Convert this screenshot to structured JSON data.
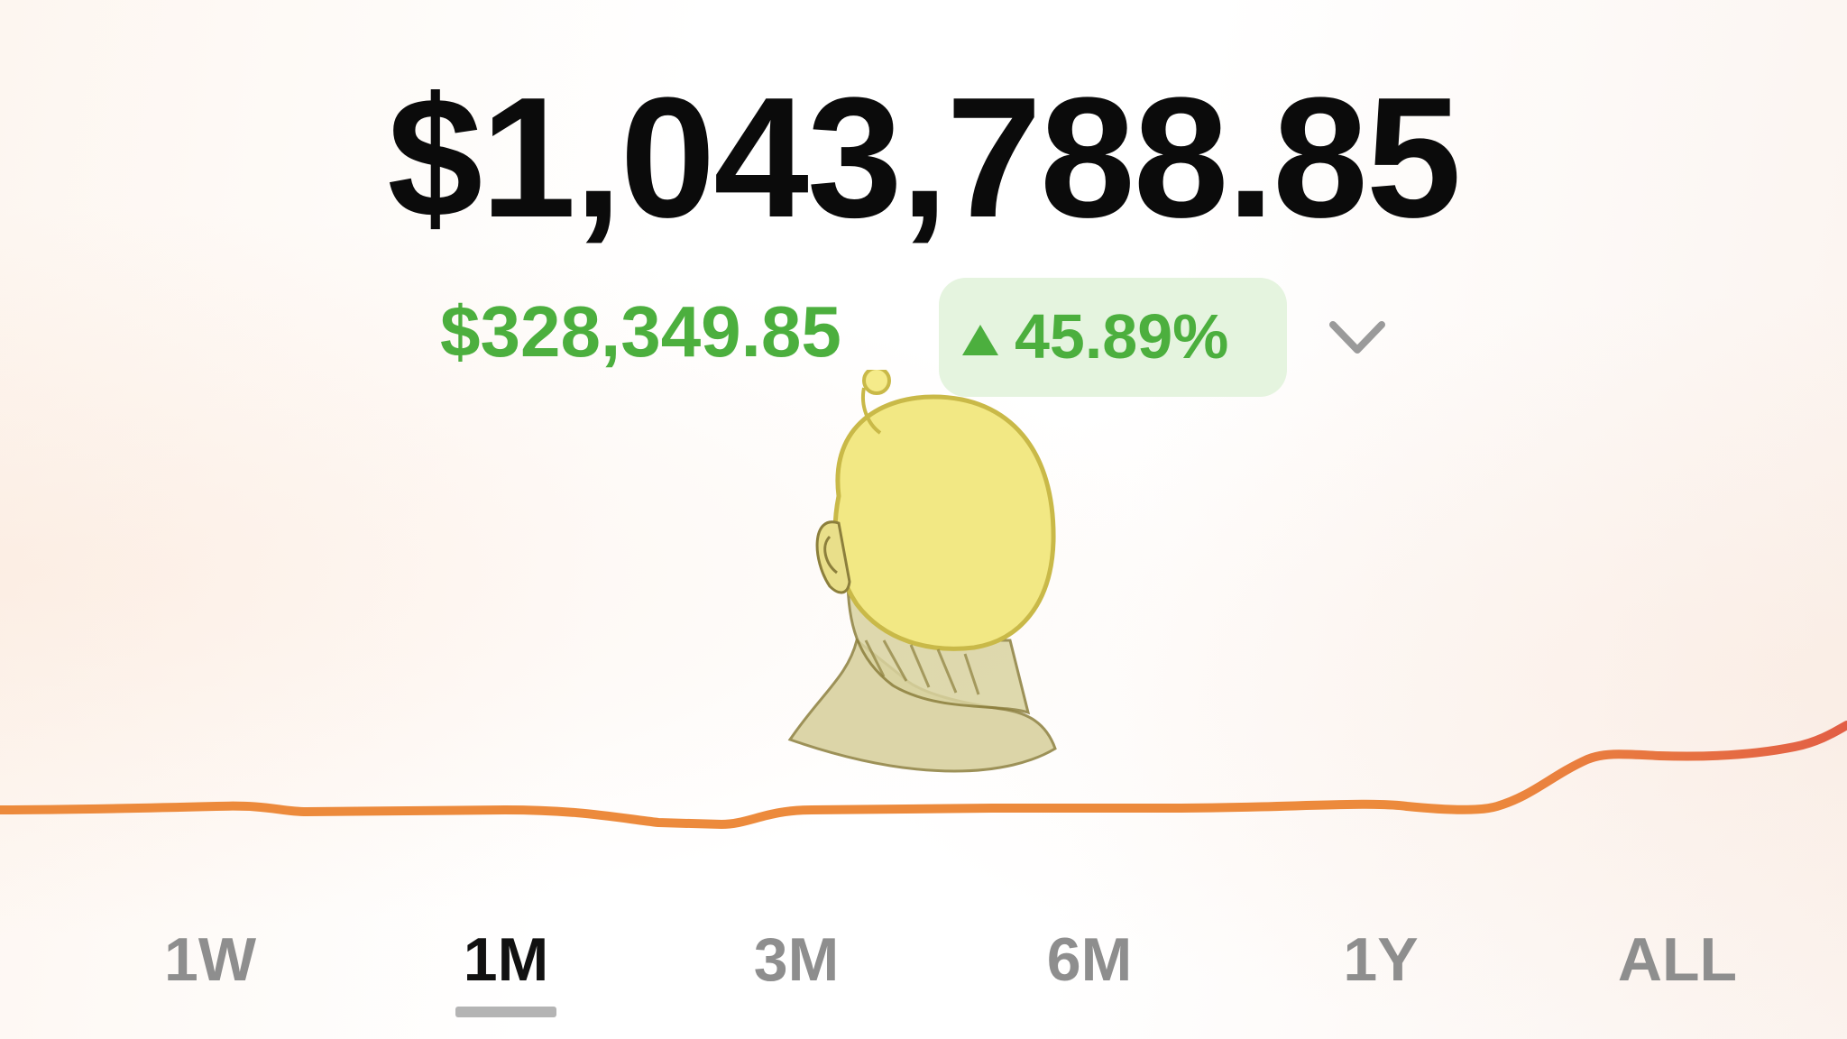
{
  "portfolio": {
    "balance": "$1,043,788.85",
    "change_amount": "$328,349.85",
    "change_percent": "45.89%"
  },
  "colors": {
    "positive": "#4caf3e",
    "positive_badge_bg": "#e5f4df",
    "chart_line": "#ec8a3c",
    "chart_line_end": "#e25e45"
  },
  "icons": {
    "change_indicator": "up-triangle-icon",
    "dropdown": "chevron-down-icon",
    "avatar": "profile-avatar-icon"
  },
  "time_ranges": [
    {
      "label": "1W",
      "selected": false
    },
    {
      "label": "1M",
      "selected": true
    },
    {
      "label": "3M",
      "selected": false
    },
    {
      "label": "6M",
      "selected": false
    },
    {
      "label": "1Y",
      "selected": false
    },
    {
      "label": "ALL",
      "selected": false
    }
  ]
}
